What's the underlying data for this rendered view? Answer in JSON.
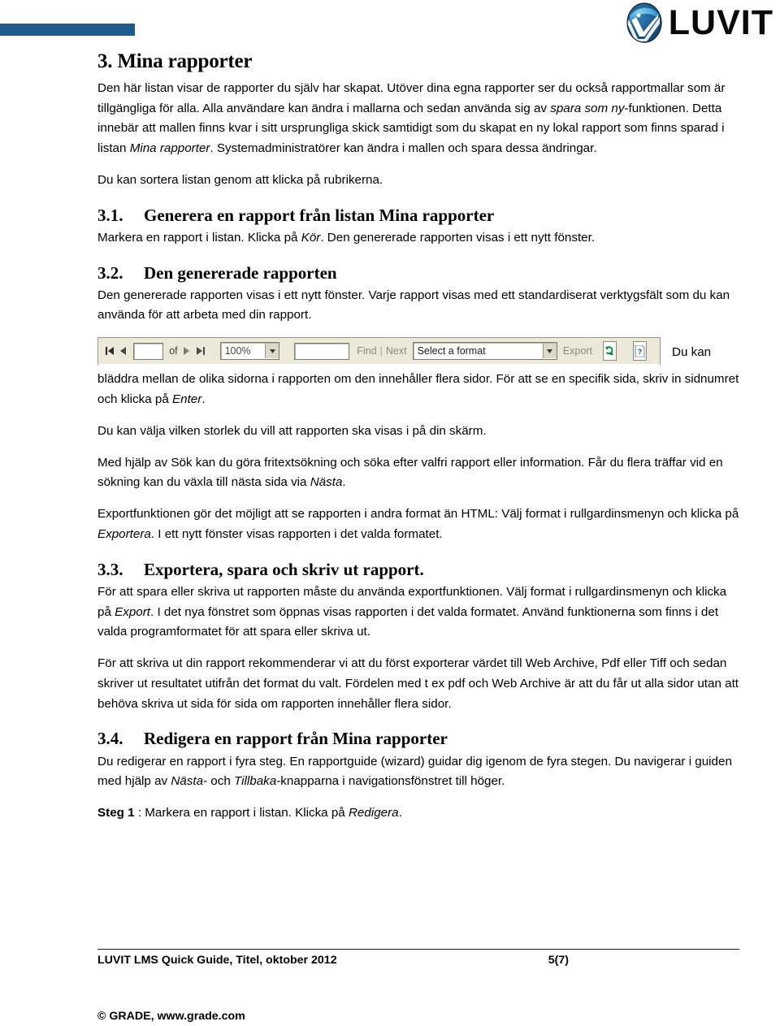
{
  "header": {
    "logo_text": "LUVIT",
    "logo_icon": "luvit-globe-icon",
    "bar_color": "#1d5b8e"
  },
  "document": {
    "h1": "3. Mina rapporter",
    "intro_1": "Den här listan visar de rapporter du själv har skapat. Utöver dina egna rapporter ser du också rapportmallar som är tillgängliga för alla. Alla användare kan ändra i mallarna och sedan använda sig av ",
    "intro_1_it": "spara som ny",
    "intro_1_b": "-funktionen. Detta innebär att mallen finns kvar i sitt ursprungliga skick samtidigt som du skapat en ny lokal rapport som finns sparad i listan ",
    "intro_1_it2": "Mina rapporter",
    "intro_1_c": ". Systemadministratörer kan ändra i mallen och spara dessa ändringar.",
    "intro_2": "Du kan sortera listan genom att klicka på rubrikerna.",
    "sections": [
      {
        "num": "3.1.",
        "title": "Generera en rapport från listan Mina rapporter",
        "body_a": "Markera en rapport i listan. Klicka på ",
        "body_it": "Kör",
        "body_b": ". Den genererade rapporten visas i ett nytt fönster."
      },
      {
        "num": "3.2.",
        "title": "Den genererade rapporten",
        "body_a": "Den genererade rapporten visas i ett nytt fönster. Varje rapport visas med ett standardiserat verktygsfält som du kan använda för att arbeta med din rapport.",
        "body_it": "",
        "body_b": ""
      },
      {
        "num": "3.3.",
        "title": "Exportera, spara och skriv ut rapport.",
        "body_a": "För att spara eller skriva ut rapporten måste du använda exportfunktionen. Välj format i rullgardinsmenyn och klicka på ",
        "body_it": "Export",
        "body_b": ". I det nya fönstret som öppnas visas rapporten i det valda formatet. Använd funktionerna som finns i det valda programformatet för att spara eller skriva ut."
      },
      {
        "num": "3.4.",
        "title": "Redigera en rapport från Mina rapporter",
        "body_a": "Du redigerar en rapport i fyra steg. En rapportguide (wizard) guidar dig igenom de fyra stegen. Du navigerar i guiden med hjälp av ",
        "body_it": "Nästa",
        "body_mid": "- och ",
        "body_it2": "Tillbaka",
        "body_b": "-knapparna i navigationsfönstret till höger."
      }
    ],
    "after_toolbar_wrap": "Du kan",
    "after_toolbar_a": "bläddra mellan de olika sidorna i rapporten om den innehåller flera sidor. För att se en specifik sida, skriv in sidnumret och klicka på ",
    "after_toolbar_it": "Enter",
    "after_toolbar_b": ".",
    "para_size": "Du kan välja vilken storlek du vill att rapporten ska visas i på din skärm.",
    "para_search_a": "Med hjälp av Sök kan du göra fritextsökning och söka efter valfri rapport eller information. Får du flera träffar vid en sökning kan du växla till nästa sida via ",
    "para_search_it": "Nästa",
    "para_search_b": ".",
    "para_export_a": "Exportfunktionen gör det möjligt att se rapporten i andra format än HTML: Välj format i rullgardinsmenyn och klicka på ",
    "para_export_it": "Exportera",
    "para_export_b": ". I ett nytt fönster visas rapporten i det valda formatet.",
    "para_print": "För att skriva ut din rapport rekommenderar vi att du först exporterar värdet till Web Archive, Pdf eller Tiff och sedan skriver ut resultatet utifrån det format du valt. Fördelen med t ex pdf och Web Archive är att du får ut alla sidor utan att behöva skriva ut sida för sida om rapporten innehåller flera sidor.",
    "steg_label": "Steg 1",
    "steg_a": " : Markera en rapport i listan. Klicka på ",
    "steg_it": "Redigera",
    "steg_b": "."
  },
  "toolbar": {
    "first_page_icon": "first-page-icon",
    "prev_page_icon": "previous-page-icon",
    "page_input_value": "",
    "of_label": "of",
    "next_page_icon": "next-page-icon",
    "last_page_icon": "last-page-icon",
    "zoom_value": "100%",
    "find_input_value": "",
    "find_label": "Find",
    "separator": "|",
    "next_label": "Next",
    "format_value": "Select a format",
    "export_label": "Export",
    "refresh_icon": "refresh-icon",
    "help_icon": "help-icon"
  },
  "footer": {
    "left": "LUVIT LMS Quick Guide, Titel, oktober 2012",
    "page": "5(7)",
    "copyright": "© GRADE, www.grade.com"
  }
}
